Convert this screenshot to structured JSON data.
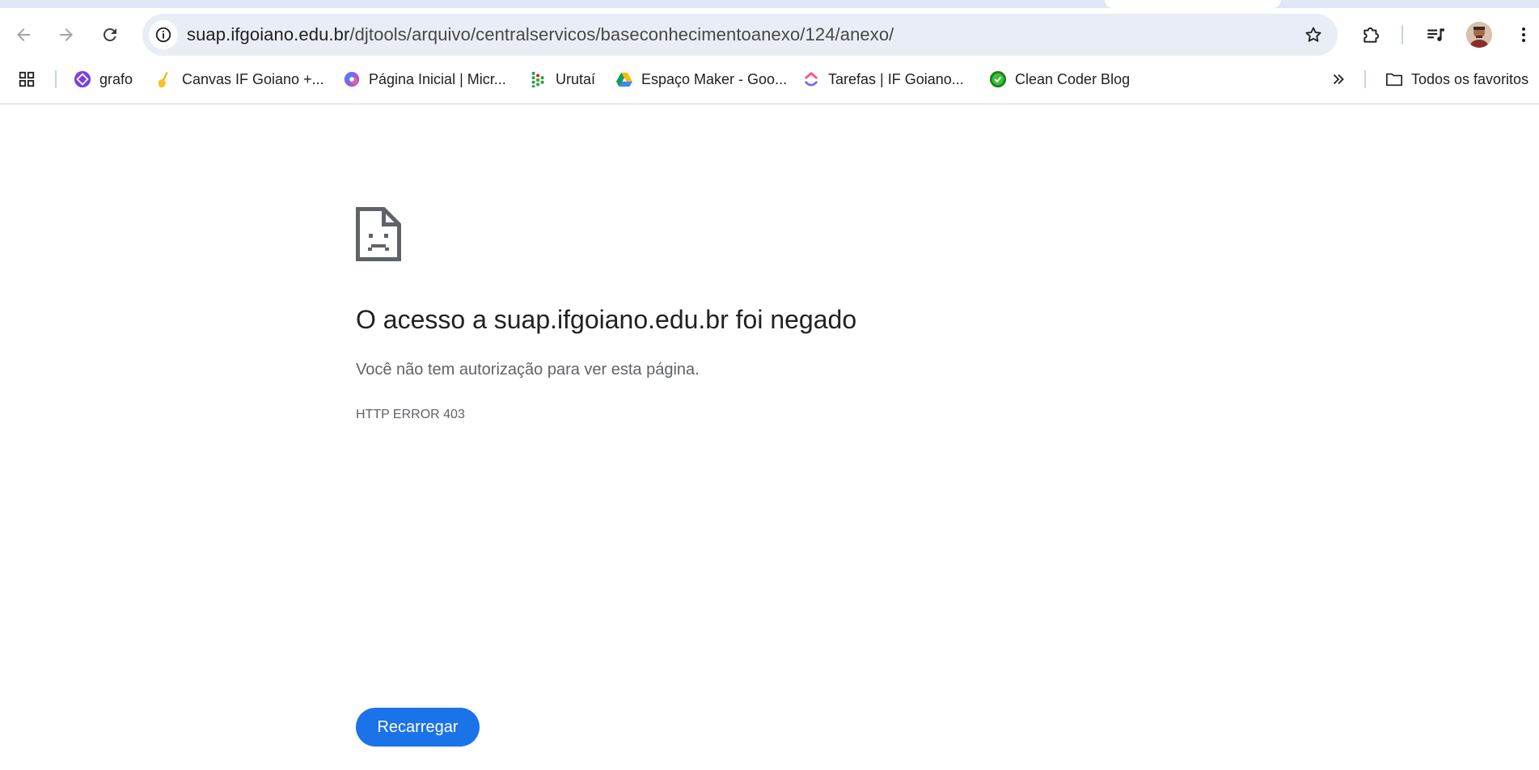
{
  "browser": {
    "url_host": "suap.ifgoiano.edu.br",
    "url_path": "/djtools/arquivo/centralservicos/baseconhecimentoanexo/124/anexo/",
    "icons": {
      "back": "arrow-left-icon",
      "forward": "arrow-right-icon",
      "reload": "reload-icon",
      "site_info": "info-icon",
      "bookmark": "star-icon",
      "extensions": "puzzle-icon",
      "media": "media-queue-icon",
      "menu": "kebab-menu-icon"
    }
  },
  "bookmarks": {
    "items": [
      {
        "label": "grafo",
        "icon": "grafo-icon"
      },
      {
        "label": "Canvas IF Goiano +...",
        "icon": "canvas-icon"
      },
      {
        "label": "Página Inicial | Micr...",
        "icon": "microsoft-icon"
      },
      {
        "label": "Urutaí",
        "icon": "urutai-icon"
      },
      {
        "label": "Espaço Maker - Goo...",
        "icon": "google-drive-icon"
      },
      {
        "label": "Tarefas | IF Goiano...",
        "icon": "clickup-icon"
      },
      {
        "label": "Clean Coder Blog",
        "icon": "clean-coder-icon"
      }
    ],
    "more_icon": "chevron-double-right-icon",
    "all_bookmarks_label": "Todos os favoritos"
  },
  "error_page": {
    "title": "O acesso a suap.ifgoiano.edu.br foi negado",
    "description": "Você não tem autorização para ver esta página.",
    "error_code": "HTTP ERROR 403",
    "reload_label": "Recarregar"
  },
  "colors": {
    "accent": "#1a73e8",
    "omnibox_bg": "#e9eef6",
    "title_text": "#202124",
    "secondary_text": "#5f6368"
  }
}
